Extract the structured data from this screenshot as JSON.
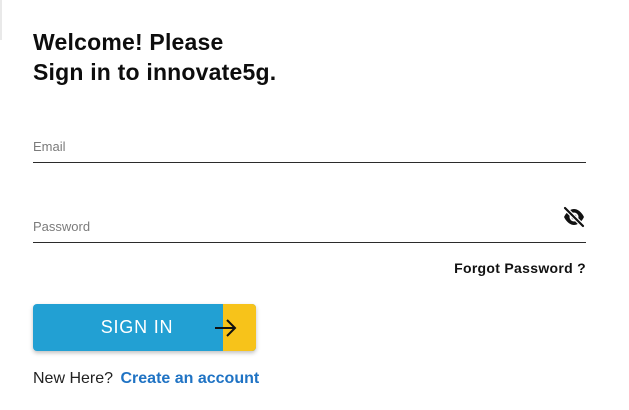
{
  "heading": {
    "line1": "Welcome! Please",
    "line2": "Sign in to innovate5g."
  },
  "email": {
    "placeholder": "Email",
    "value": ""
  },
  "password": {
    "placeholder": "Password",
    "value": "",
    "toggle_icon": "eye-slash-icon"
  },
  "forgot_password": {
    "label": "Forgot Password ?"
  },
  "signin": {
    "label": "SIGN IN",
    "icon": "arrow-right-icon"
  },
  "signup": {
    "prompt": "New Here?",
    "link_label": "Create an account"
  },
  "colors": {
    "primary": "#22a0d3",
    "accent": "#f7c31a",
    "link": "#1f73c4",
    "text": "#0d0d0d"
  }
}
